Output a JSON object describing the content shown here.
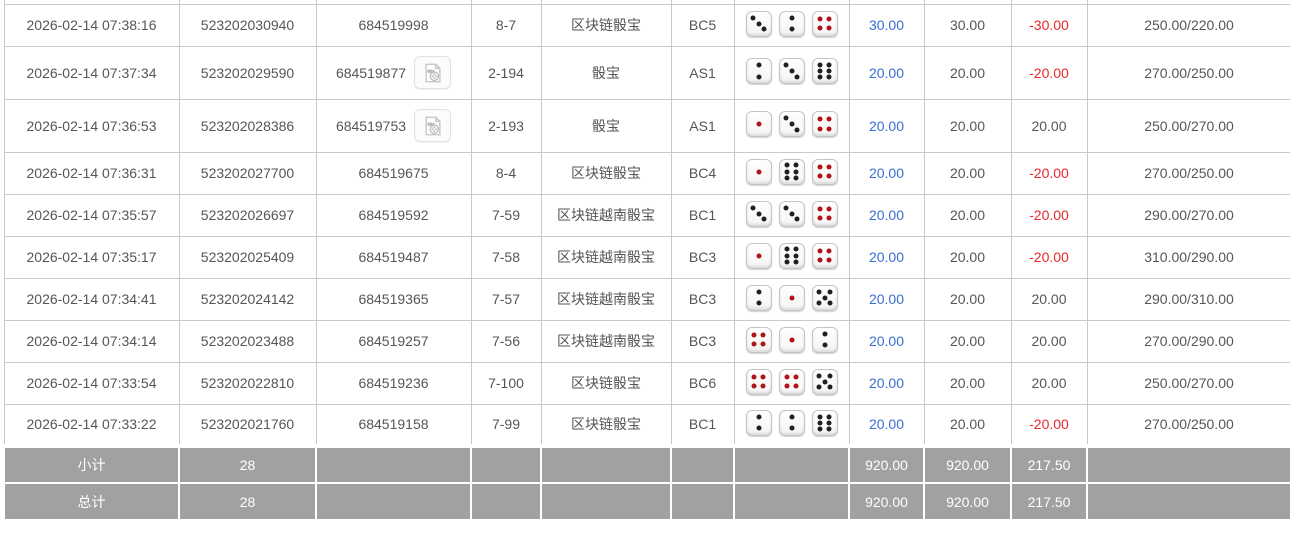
{
  "colors": {
    "accent_blue": "#3a6fd1",
    "negative_red": "#e8262c",
    "summary_background": "#a1a1a1",
    "grid_border": "#c9c9c9",
    "dice_pip_black": "#1f1f1f",
    "dice_pip_red": "#b01217"
  },
  "rows": [
    {
      "time": "2026-02-14 07:38:16",
      "order_no": "523202030940",
      "bet_id": "684519998",
      "video": false,
      "round": "8-7",
      "game": "区块链骰宝",
      "table_code": "BC5",
      "dice": [
        {
          "value": 3,
          "color": "black"
        },
        {
          "value": 2,
          "color": "black"
        },
        {
          "value": 4,
          "color": "red"
        }
      ],
      "bet": "30.00",
      "valid": "30.00",
      "net": "-30.00",
      "balance": "250.00/220.00"
    },
    {
      "time": "2026-02-14 07:37:34",
      "order_no": "523202029590",
      "bet_id": "684519877",
      "video": true,
      "round": "2-194",
      "game": "骰宝",
      "table_code": "AS1",
      "dice": [
        {
          "value": 2,
          "color": "black"
        },
        {
          "value": 3,
          "color": "black"
        },
        {
          "value": 6,
          "color": "black"
        }
      ],
      "bet": "20.00",
      "valid": "20.00",
      "net": "-20.00",
      "balance": "270.00/250.00"
    },
    {
      "time": "2026-02-14 07:36:53",
      "order_no": "523202028386",
      "bet_id": "684519753",
      "video": true,
      "round": "2-193",
      "game": "骰宝",
      "table_code": "AS1",
      "dice": [
        {
          "value": 1,
          "color": "red"
        },
        {
          "value": 3,
          "color": "black"
        },
        {
          "value": 4,
          "color": "red"
        }
      ],
      "bet": "20.00",
      "valid": "20.00",
      "net": "20.00",
      "balance": "250.00/270.00"
    },
    {
      "time": "2026-02-14 07:36:31",
      "order_no": "523202027700",
      "bet_id": "684519675",
      "video": false,
      "round": "8-4",
      "game": "区块链骰宝",
      "table_code": "BC4",
      "dice": [
        {
          "value": 1,
          "color": "red"
        },
        {
          "value": 6,
          "color": "black"
        },
        {
          "value": 4,
          "color": "red"
        }
      ],
      "bet": "20.00",
      "valid": "20.00",
      "net": "-20.00",
      "balance": "270.00/250.00"
    },
    {
      "time": "2026-02-14 07:35:57",
      "order_no": "523202026697",
      "bet_id": "684519592",
      "video": false,
      "round": "7-59",
      "game": "区块链越南骰宝",
      "table_code": "BC1",
      "dice": [
        {
          "value": 3,
          "color": "black"
        },
        {
          "value": 3,
          "color": "black"
        },
        {
          "value": 4,
          "color": "red"
        }
      ],
      "bet": "20.00",
      "valid": "20.00",
      "net": "-20.00",
      "balance": "290.00/270.00"
    },
    {
      "time": "2026-02-14 07:35:17",
      "order_no": "523202025409",
      "bet_id": "684519487",
      "video": false,
      "round": "7-58",
      "game": "区块链越南骰宝",
      "table_code": "BC3",
      "dice": [
        {
          "value": 1,
          "color": "red"
        },
        {
          "value": 6,
          "color": "black"
        },
        {
          "value": 4,
          "color": "red"
        }
      ],
      "bet": "20.00",
      "valid": "20.00",
      "net": "-20.00",
      "balance": "310.00/290.00"
    },
    {
      "time": "2026-02-14 07:34:41",
      "order_no": "523202024142",
      "bet_id": "684519365",
      "video": false,
      "round": "7-57",
      "game": "区块链越南骰宝",
      "table_code": "BC3",
      "dice": [
        {
          "value": 2,
          "color": "black"
        },
        {
          "value": 1,
          "color": "red"
        },
        {
          "value": 5,
          "color": "black"
        }
      ],
      "bet": "20.00",
      "valid": "20.00",
      "net": "20.00",
      "balance": "290.00/310.00"
    },
    {
      "time": "2026-02-14 07:34:14",
      "order_no": "523202023488",
      "bet_id": "684519257",
      "video": false,
      "round": "7-56",
      "game": "区块链越南骰宝",
      "table_code": "BC3",
      "dice": [
        {
          "value": 4,
          "color": "red"
        },
        {
          "value": 1,
          "color": "red"
        },
        {
          "value": 2,
          "color": "black"
        }
      ],
      "bet": "20.00",
      "valid": "20.00",
      "net": "20.00",
      "balance": "270.00/290.00"
    },
    {
      "time": "2026-02-14 07:33:54",
      "order_no": "523202022810",
      "bet_id": "684519236",
      "video": false,
      "round": "7-100",
      "game": "区块链骰宝",
      "table_code": "BC6",
      "dice": [
        {
          "value": 4,
          "color": "red"
        },
        {
          "value": 4,
          "color": "red"
        },
        {
          "value": 5,
          "color": "black"
        }
      ],
      "bet": "20.00",
      "valid": "20.00",
      "net": "20.00",
      "balance": "250.00/270.00"
    },
    {
      "time": "2026-02-14 07:33:22",
      "order_no": "523202021760",
      "bet_id": "684519158",
      "video": false,
      "round": "7-99",
      "game": "区块链骰宝",
      "table_code": "BC1",
      "dice": [
        {
          "value": 2,
          "color": "black"
        },
        {
          "value": 2,
          "color": "black"
        },
        {
          "value": 6,
          "color": "black"
        }
      ],
      "bet": "20.00",
      "valid": "20.00",
      "net": "-20.00",
      "balance": "270.00/250.00"
    }
  ],
  "summary": [
    {
      "label": "小计",
      "count": "28",
      "bet_total": "920.00",
      "valid_total": "920.00",
      "net_total": "217.50"
    },
    {
      "label": "总计",
      "count": "28",
      "bet_total": "920.00",
      "valid_total": "920.00",
      "net_total": "217.50"
    }
  ]
}
